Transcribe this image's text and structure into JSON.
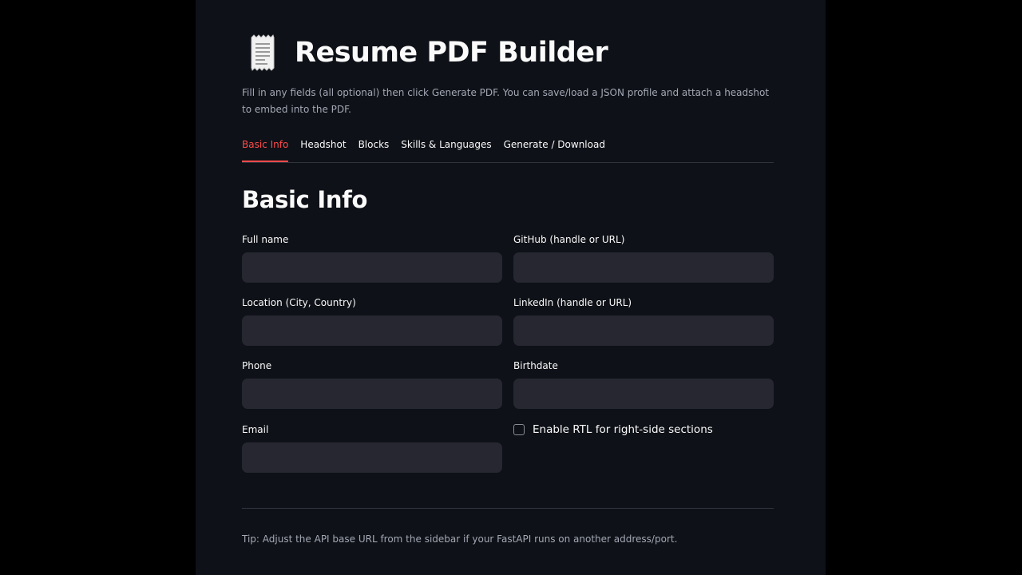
{
  "header": {
    "icon": "receipt-icon",
    "title": "Resume PDF Builder",
    "intro": "Fill in any fields (all optional) then click Generate PDF. You can save/load a JSON profile and attach a headshot to embed into the PDF."
  },
  "tabs": [
    {
      "label": "Basic Info",
      "active": true
    },
    {
      "label": "Headshot",
      "active": false
    },
    {
      "label": "Blocks",
      "active": false
    },
    {
      "label": "Skills & Languages",
      "active": false
    },
    {
      "label": "Generate / Download",
      "active": false
    }
  ],
  "section": {
    "title": "Basic Info"
  },
  "fields": {
    "full_name": {
      "label": "Full name",
      "value": ""
    },
    "github": {
      "label": "GitHub (handle or URL)",
      "value": ""
    },
    "location": {
      "label": "Location (City, Country)",
      "value": ""
    },
    "linkedin": {
      "label": "LinkedIn (handle or URL)",
      "value": ""
    },
    "phone": {
      "label": "Phone",
      "value": ""
    },
    "birthdate": {
      "label": "Birthdate",
      "value": ""
    },
    "email": {
      "label": "Email",
      "value": ""
    }
  },
  "rtl_checkbox": {
    "label": "Enable RTL for right-side sections",
    "checked": false
  },
  "footer": {
    "tip": "Tip: Adjust the API base URL from the sidebar if your FastAPI runs on another address/port."
  },
  "colors": {
    "background": "#0e1117",
    "accent": "#ff4b4b",
    "input_bg": "#262730",
    "text": "#fafafa",
    "muted_text": "#a3a8b4"
  }
}
